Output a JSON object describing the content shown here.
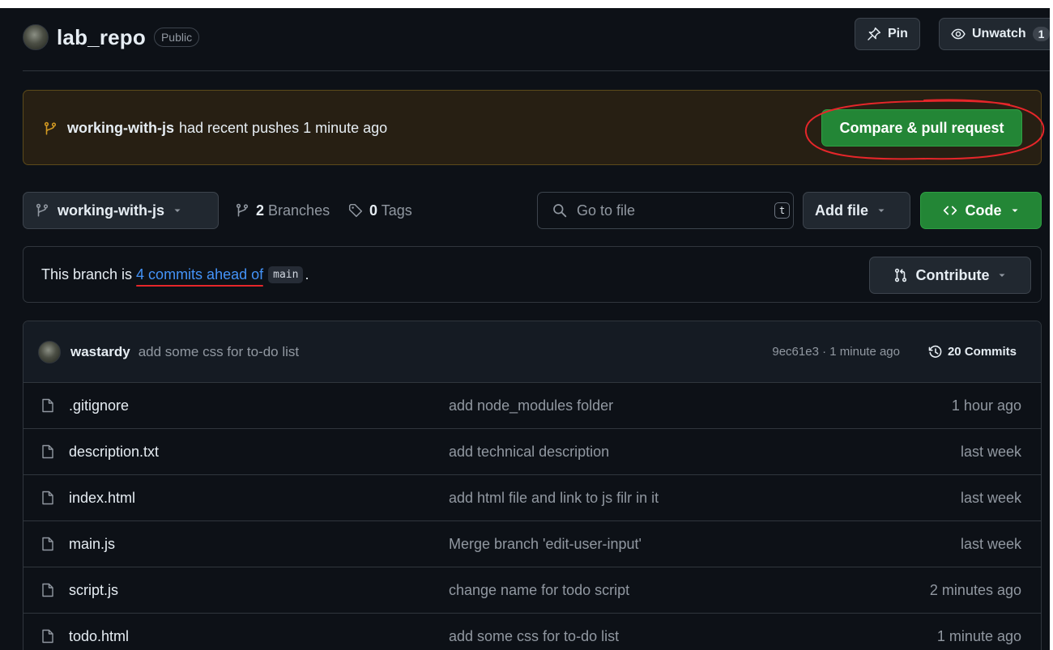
{
  "repo": {
    "name": "lab_repo",
    "visibility": "Public",
    "pin_label": "Pin",
    "unwatch_label": "Unwatch",
    "watch_count": "1"
  },
  "banner": {
    "branch": "working-with-js",
    "text": "had recent pushes 1 minute ago",
    "button_label": "Compare & pull request"
  },
  "toolbar": {
    "branch_selector": "working-with-js",
    "branches_count": "2",
    "branches_label": "Branches",
    "tags_count": "0",
    "tags_label": "Tags",
    "search_placeholder": "Go to file",
    "search_shortcut": "t",
    "add_file_label": "Add file",
    "code_label": "Code"
  },
  "ahead": {
    "prefix": "This branch is ",
    "link_text": "4 commits ahead of",
    "base_branch": "main",
    "suffix": ".",
    "contribute_label": "Contribute"
  },
  "latest_commit": {
    "author": "wastardy",
    "message": "add some css for to-do list",
    "meta": "9ec61e3 · 1 minute ago",
    "commits_label": "20 Commits"
  },
  "files": [
    {
      "name": ".gitignore",
      "message": "add node_modules folder",
      "time": "1 hour ago"
    },
    {
      "name": "description.txt",
      "message": "add technical description",
      "time": "last week"
    },
    {
      "name": "index.html",
      "message": "add html file and link to js filr in it",
      "time": "last week"
    },
    {
      "name": "main.js",
      "message": "Merge branch 'edit-user-input'",
      "time": "last week"
    },
    {
      "name": "script.js",
      "message": "change name for todo script",
      "time": "2 minutes ago"
    },
    {
      "name": "todo.html",
      "message": "add some css for to-do list",
      "time": "1 minute ago"
    }
  ],
  "colors": {
    "background": "#0d1117",
    "primary_button": "#238636",
    "link": "#4493f8",
    "annotation_red": "#e5262a",
    "banner_bg": "#271f13"
  },
  "icons": {
    "branch": "git-branch-icon",
    "tag": "tag-icon",
    "pin": "pin-icon",
    "eye": "eye-icon",
    "search": "search-icon",
    "history": "history-icon",
    "file": "file-icon",
    "pull_request": "git-pull-request-icon",
    "code": "code-icon"
  }
}
